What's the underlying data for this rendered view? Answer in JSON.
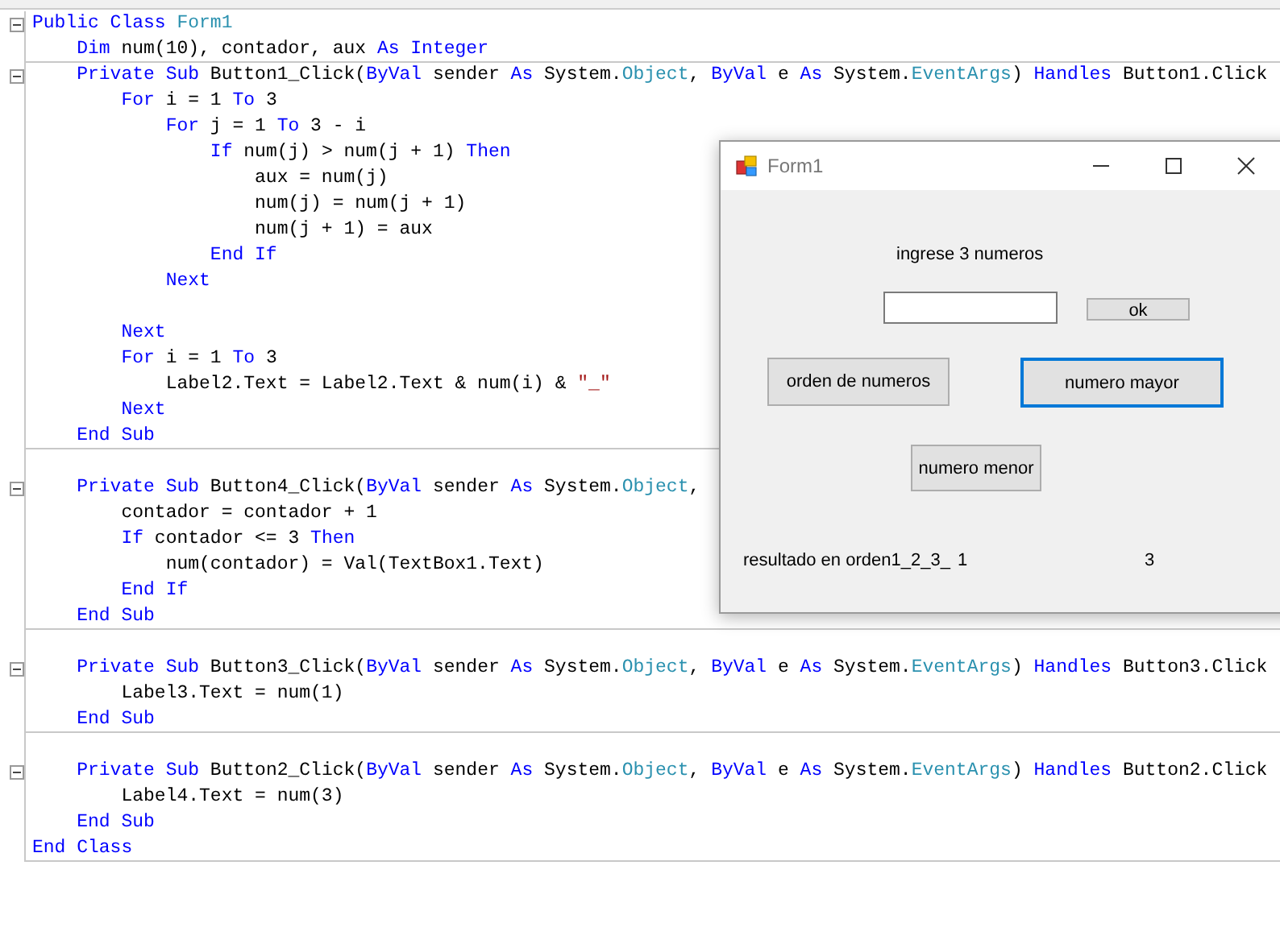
{
  "editor": {
    "lines": [
      {
        "collapsible": true,
        "separator_after": false,
        "tokens": [
          {
            "kind": "keyword",
            "text": "Public Class "
          },
          {
            "kind": "type",
            "text": "Form1"
          }
        ]
      },
      {
        "collapsible": false,
        "separator_after": true,
        "tokens": [
          {
            "kind": "keyword",
            "text": "    Dim"
          },
          {
            "kind": "plain",
            "text": " num(10), contador, aux "
          },
          {
            "kind": "keyword",
            "text": "As Integer"
          }
        ]
      },
      {
        "collapsible": true,
        "separator_after": false,
        "tokens": [
          {
            "kind": "keyword",
            "text": "    Private Sub"
          },
          {
            "kind": "plain",
            "text": " Button1_Click("
          },
          {
            "kind": "keyword",
            "text": "ByVal"
          },
          {
            "kind": "plain",
            "text": " sender "
          },
          {
            "kind": "keyword",
            "text": "As"
          },
          {
            "kind": "plain",
            "text": " System."
          },
          {
            "kind": "type",
            "text": "Object"
          },
          {
            "kind": "plain",
            "text": ", "
          },
          {
            "kind": "keyword",
            "text": "ByVal"
          },
          {
            "kind": "plain",
            "text": " e "
          },
          {
            "kind": "keyword",
            "text": "As"
          },
          {
            "kind": "plain",
            "text": " System."
          },
          {
            "kind": "type",
            "text": "EventArgs"
          },
          {
            "kind": "plain",
            "text": ") "
          },
          {
            "kind": "keyword",
            "text": "Handles"
          },
          {
            "kind": "plain",
            "text": " Button1.Click"
          }
        ]
      },
      {
        "collapsible": false,
        "separator_after": false,
        "tokens": [
          {
            "kind": "keyword",
            "text": "        For"
          },
          {
            "kind": "plain",
            "text": " i = 1 "
          },
          {
            "kind": "keyword",
            "text": "To"
          },
          {
            "kind": "plain",
            "text": " 3"
          }
        ]
      },
      {
        "collapsible": false,
        "separator_after": false,
        "tokens": [
          {
            "kind": "keyword",
            "text": "            For"
          },
          {
            "kind": "plain",
            "text": " j = 1 "
          },
          {
            "kind": "keyword",
            "text": "To"
          },
          {
            "kind": "plain",
            "text": " 3 - i"
          }
        ]
      },
      {
        "collapsible": false,
        "separator_after": false,
        "tokens": [
          {
            "kind": "keyword",
            "text": "                If"
          },
          {
            "kind": "plain",
            "text": " num(j) > num(j + 1) "
          },
          {
            "kind": "keyword",
            "text": "Then"
          }
        ]
      },
      {
        "collapsible": false,
        "separator_after": false,
        "tokens": [
          {
            "kind": "plain",
            "text": "                    aux = num(j)"
          }
        ]
      },
      {
        "collapsible": false,
        "separator_after": false,
        "tokens": [
          {
            "kind": "plain",
            "text": "                    num(j) = num(j + 1)"
          }
        ]
      },
      {
        "collapsible": false,
        "separator_after": false,
        "tokens": [
          {
            "kind": "plain",
            "text": "                    num(j + 1) = aux"
          }
        ]
      },
      {
        "collapsible": false,
        "separator_after": false,
        "tokens": [
          {
            "kind": "keyword",
            "text": "                End If"
          }
        ]
      },
      {
        "collapsible": false,
        "separator_after": false,
        "tokens": [
          {
            "kind": "keyword",
            "text": "            Next"
          }
        ]
      },
      {
        "collapsible": false,
        "separator_after": false
      },
      {
        "collapsible": false,
        "separator_after": false,
        "tokens": [
          {
            "kind": "keyword",
            "text": "        Next"
          }
        ]
      },
      {
        "collapsible": false,
        "separator_after": false,
        "tokens": [
          {
            "kind": "keyword",
            "text": "        For"
          },
          {
            "kind": "plain",
            "text": " i = 1 "
          },
          {
            "kind": "keyword",
            "text": "To"
          },
          {
            "kind": "plain",
            "text": " 3"
          }
        ]
      },
      {
        "collapsible": false,
        "separator_after": false,
        "tokens": [
          {
            "kind": "plain",
            "text": "            Label2.Text = Label2.Text & num(i) & "
          },
          {
            "kind": "string",
            "text": "\"_\""
          }
        ]
      },
      {
        "collapsible": false,
        "separator_after": false,
        "tokens": [
          {
            "kind": "keyword",
            "text": "        Next"
          }
        ]
      },
      {
        "collapsible": false,
        "separator_after": true,
        "tokens": [
          {
            "kind": "keyword",
            "text": "    End Sub"
          }
        ]
      },
      {
        "collapsible": false,
        "separator_after": false
      },
      {
        "collapsible": true,
        "separator_after": false,
        "tokens": [
          {
            "kind": "keyword",
            "text": "    Private Sub"
          },
          {
            "kind": "plain",
            "text": " Button4_Click("
          },
          {
            "kind": "keyword",
            "text": "ByVal"
          },
          {
            "kind": "plain",
            "text": " sender "
          },
          {
            "kind": "keyword",
            "text": "As"
          },
          {
            "kind": "plain",
            "text": " System."
          },
          {
            "kind": "type",
            "text": "Object"
          },
          {
            "kind": "plain",
            "text": ","
          }
        ]
      },
      {
        "collapsible": false,
        "separator_after": false,
        "tokens": [
          {
            "kind": "plain",
            "text": "        contador = contador + 1"
          }
        ]
      },
      {
        "collapsible": false,
        "separator_after": false,
        "tokens": [
          {
            "kind": "keyword",
            "text": "        If"
          },
          {
            "kind": "plain",
            "text": " contador <= 3 "
          },
          {
            "kind": "keyword",
            "text": "Then"
          }
        ]
      },
      {
        "collapsible": false,
        "separator_after": false,
        "tokens": [
          {
            "kind": "plain",
            "text": "            num(contador) = Val(TextBox1.Text)"
          }
        ]
      },
      {
        "collapsible": false,
        "separator_after": false,
        "tokens": [
          {
            "kind": "keyword",
            "text": "        End If"
          }
        ]
      },
      {
        "collapsible": false,
        "separator_after": true,
        "tokens": [
          {
            "kind": "keyword",
            "text": "    End Sub"
          }
        ]
      },
      {
        "collapsible": false,
        "separator_after": false
      },
      {
        "collapsible": true,
        "separator_after": false,
        "tokens": [
          {
            "kind": "keyword",
            "text": "    Private Sub"
          },
          {
            "kind": "plain",
            "text": " Button3_Click("
          },
          {
            "kind": "keyword",
            "text": "ByVal"
          },
          {
            "kind": "plain",
            "text": " sender "
          },
          {
            "kind": "keyword",
            "text": "As"
          },
          {
            "kind": "plain",
            "text": " System."
          },
          {
            "kind": "type",
            "text": "Object"
          },
          {
            "kind": "plain",
            "text": ", "
          },
          {
            "kind": "keyword",
            "text": "ByVal"
          },
          {
            "kind": "plain",
            "text": " e "
          },
          {
            "kind": "keyword",
            "text": "As"
          },
          {
            "kind": "plain",
            "text": " System."
          },
          {
            "kind": "type",
            "text": "EventArgs"
          },
          {
            "kind": "plain",
            "text": ") "
          },
          {
            "kind": "keyword",
            "text": "Handles"
          },
          {
            "kind": "plain",
            "text": " Button3.Click"
          }
        ]
      },
      {
        "collapsible": false,
        "separator_after": false,
        "tokens": [
          {
            "kind": "plain",
            "text": "        Label3.Text = num(1)"
          }
        ]
      },
      {
        "collapsible": false,
        "separator_after": true,
        "tokens": [
          {
            "kind": "keyword",
            "text": "    End Sub"
          }
        ]
      },
      {
        "collapsible": false,
        "separator_after": false
      },
      {
        "collapsible": true,
        "separator_after": false,
        "tokens": [
          {
            "kind": "keyword",
            "text": "    Private Sub"
          },
          {
            "kind": "plain",
            "text": " Button2_Click("
          },
          {
            "kind": "keyword",
            "text": "ByVal"
          },
          {
            "kind": "plain",
            "text": " sender "
          },
          {
            "kind": "keyword",
            "text": "As"
          },
          {
            "kind": "plain",
            "text": " System."
          },
          {
            "kind": "type",
            "text": "Object"
          },
          {
            "kind": "plain",
            "text": ", "
          },
          {
            "kind": "keyword",
            "text": "ByVal"
          },
          {
            "kind": "plain",
            "text": " e "
          },
          {
            "kind": "keyword",
            "text": "As"
          },
          {
            "kind": "plain",
            "text": " System."
          },
          {
            "kind": "type",
            "text": "EventArgs"
          },
          {
            "kind": "plain",
            "text": ") "
          },
          {
            "kind": "keyword",
            "text": "Handles"
          },
          {
            "kind": "plain",
            "text": " Button2.Click"
          }
        ]
      },
      {
        "collapsible": false,
        "separator_after": false,
        "tokens": [
          {
            "kind": "plain",
            "text": "        Label4.Text = num(3)"
          }
        ]
      },
      {
        "collapsible": false,
        "separator_after": false,
        "tokens": [
          {
            "kind": "keyword",
            "text": "    End Sub"
          }
        ]
      },
      {
        "collapsible": false,
        "separator_after": true,
        "tokens": [
          {
            "kind": "keyword",
            "text": "End Class"
          }
        ]
      }
    ]
  },
  "form_window": {
    "title": "Form1",
    "prompt_label": "ingrese 3 numeros",
    "ok_button": "ok",
    "buttons": [
      {
        "label": "orden de numeros",
        "focused": false
      },
      {
        "label": "numero mayor",
        "focused": true
      },
      {
        "label": "numero menor",
        "focused": false
      }
    ],
    "result_label": "resultado en orden1_2_3_",
    "min_label": "1",
    "max_label": "3"
  }
}
